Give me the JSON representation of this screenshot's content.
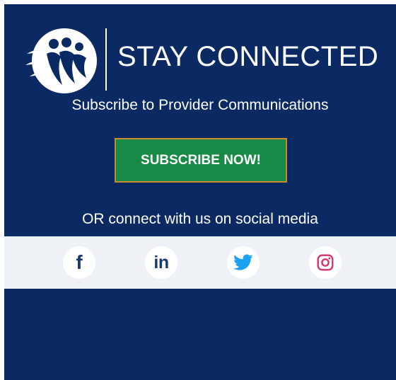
{
  "colors": {
    "panel_bg": "#0b2a63",
    "button_bg": "#178a45",
    "button_border": "#c88a2c",
    "social_bar_bg": "#eef1f6",
    "twitter_blue": "#1da1f2",
    "instagram_red": "#d6336c",
    "icon_navy": "#1b3a6b"
  },
  "header": {
    "title": "STAY CONNECTED",
    "logo_icon": "people-circle-logo-icon"
  },
  "subscribe": {
    "text": "Subscribe to Provider Communications",
    "button_label": "SUBSCRIBE NOW!"
  },
  "social": {
    "intro": "OR connect with us on social media",
    "items": [
      {
        "name": "facebook",
        "icon": "facebook-icon",
        "glyph": "f"
      },
      {
        "name": "linkedin",
        "icon": "linkedin-icon",
        "glyph": "in"
      },
      {
        "name": "twitter",
        "icon": "twitter-icon"
      },
      {
        "name": "instagram",
        "icon": "instagram-icon"
      }
    ]
  }
}
